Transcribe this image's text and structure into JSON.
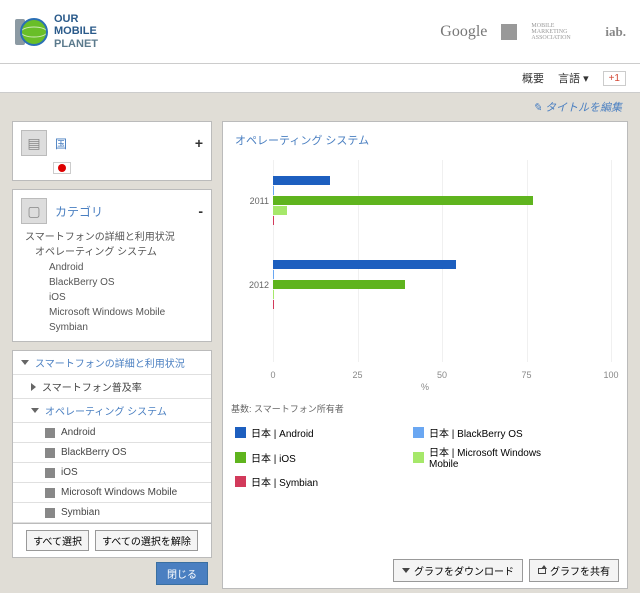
{
  "header": {
    "logo_l1": "OUR",
    "logo_l2": "MOBILE",
    "logo_l3": "PLANET",
    "sponsors": [
      "Google",
      "MOBILE MARKETING ASSOCIATION",
      "iab."
    ]
  },
  "sub": {
    "overview": "概要",
    "lang": "言語 ▾",
    "gplus": "+1"
  },
  "edit_title": "✎ タイトルを編集",
  "country": {
    "label": "国",
    "toggle": "+"
  },
  "category": {
    "label": "カテゴリ",
    "toggle": "-",
    "desc": "スマートフォンの詳細と利用状況",
    "sub": "オペレーティング システム",
    "items": [
      "Android",
      "BlackBerry OS",
      "iOS",
      "Microsoft Windows Mobile",
      "Symbian"
    ]
  },
  "tree": {
    "r0": "スマートフォンの詳細と利用状況",
    "r1": "スマートフォン普及率",
    "r2": "オペレーティング システム",
    "leaves": [
      "Android",
      "BlackBerry OS",
      "iOS",
      "Microsoft Windows Mobile",
      "Symbian"
    ]
  },
  "buttons": {
    "select_all": "すべて選択",
    "deselect_all": "すべての選択を解除",
    "close": "閉じる",
    "download": "グラフをダウンロード",
    "share": "グラフを共有"
  },
  "chart_title": "オペレーティング システム",
  "footnote": "基数: スマートフォン所有者",
  "legend": [
    {
      "label": "日本 | Android",
      "color": "#1d5fbf"
    },
    {
      "label": "日本 | BlackBerry OS",
      "color": "#6aa7f2"
    },
    {
      "label": "日本 | iOS",
      "color": "#5fb41e"
    },
    {
      "label": "日本 | Microsoft Windows Mobile",
      "color": "#a6e86a"
    },
    {
      "label": "日本 | Symbian",
      "color": "#d23a5b"
    }
  ],
  "xlabel": "%",
  "chart_data": {
    "type": "bar",
    "orientation": "horizontal",
    "categories": [
      "2011",
      "2012"
    ],
    "xlim": [
      0,
      100
    ],
    "xticks": [
      0,
      25,
      50,
      75,
      100
    ],
    "xlabel": "%",
    "series": [
      {
        "name": "日本 | Android",
        "color": "#1d5fbf",
        "values": [
          17,
          54
        ]
      },
      {
        "name": "日本 | BlackBerry OS",
        "color": "#6aa7f2",
        "values": [
          0.3,
          0.3
        ]
      },
      {
        "name": "日本 | iOS",
        "color": "#5fb41e",
        "values": [
          77,
          39
        ]
      },
      {
        "name": "日本 | Microsoft Windows Mobile",
        "color": "#a6e86a",
        "values": [
          4,
          0.3
        ]
      },
      {
        "name": "日本 | Symbian",
        "color": "#d23a5b",
        "values": [
          0.3,
          0.3
        ]
      }
    ]
  }
}
